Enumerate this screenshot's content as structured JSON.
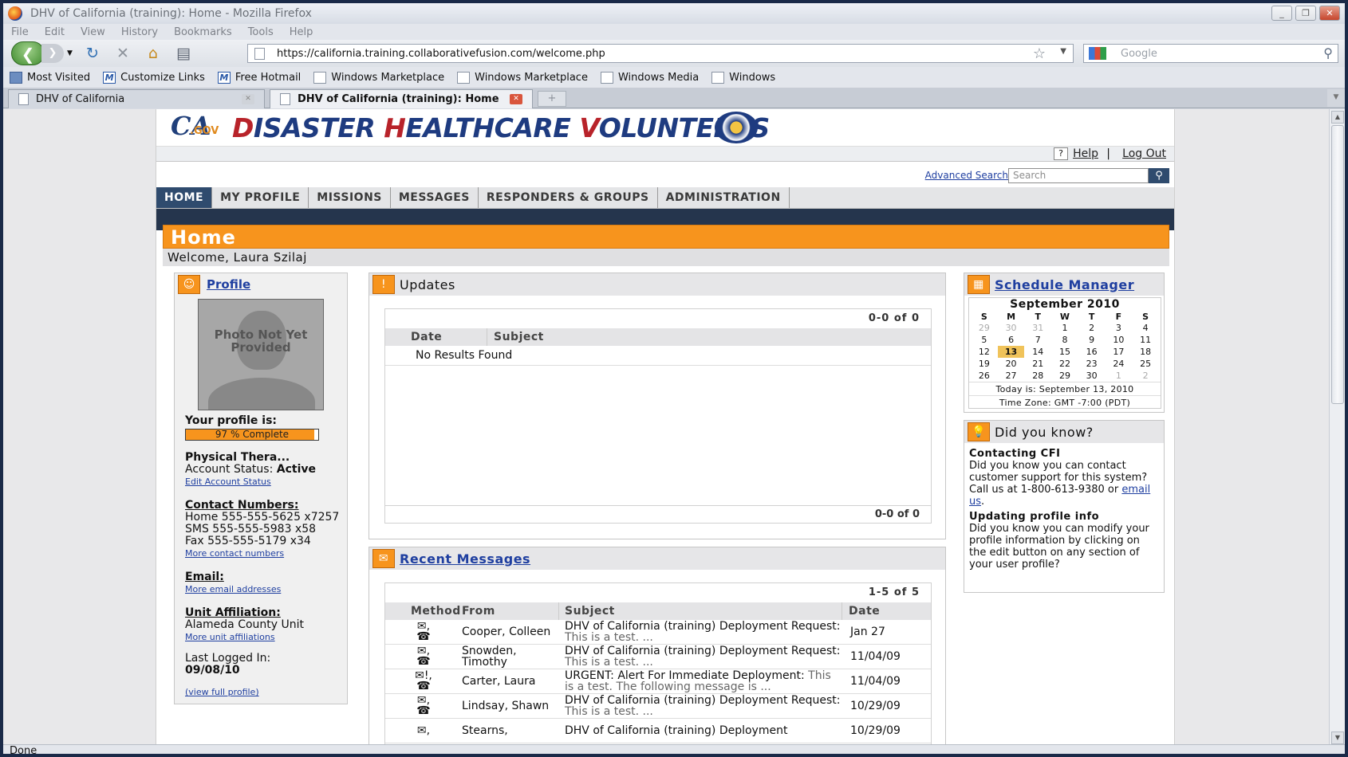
{
  "window": {
    "title": "DHV of California (training): Home - Mozilla Firefox"
  },
  "menu": [
    "File",
    "Edit",
    "View",
    "History",
    "Bookmarks",
    "Tools",
    "Help"
  ],
  "nav": {
    "url": "https://california.training.collaborativefusion.com/welcome.php",
    "search_placeholder": "Google"
  },
  "bookmarks": [
    {
      "label": "Most Visited"
    },
    {
      "label": "Customize Links"
    },
    {
      "label": "Free Hotmail"
    },
    {
      "label": "Windows Marketplace"
    },
    {
      "label": "Windows Marketplace"
    },
    {
      "label": "Windows Media"
    },
    {
      "label": "Windows"
    }
  ],
  "tabs": [
    {
      "label": "DHV of California"
    },
    {
      "label": "DHV of California (training): Home"
    }
  ],
  "site": {
    "logo_ca": "CA",
    "logo_gov": ".GOV",
    "logo_w1": "D",
    "logo_r1": "ISASTER ",
    "logo_w2": "H",
    "logo_r2": "EALTHCARE ",
    "logo_w3": "V",
    "logo_r3": "OLUNTEERS",
    "help": "Help",
    "logout": "Log Out",
    "advanced_search": "Advanced Search",
    "search_placeholder": "Search"
  },
  "mainnav": [
    "HOME",
    "MY PROFILE",
    "MISSIONS",
    "MESSAGES",
    "RESPONDERS & GROUPS",
    "ADMINISTRATION"
  ],
  "page": {
    "title": "Home",
    "welcome": "Welcome, Laura Szilaj"
  },
  "profile": {
    "heading": "Profile",
    "photo_text": "Photo Not Yet Provided",
    "your_profile": "Your profile is:",
    "complete_label": "97 % Complete",
    "complete_fraction": 0.97,
    "role": "Physical Thera...",
    "account_status_label": "Account Status:",
    "account_status": "Active",
    "edit_status": "Edit Account Status",
    "contact_heading": "Contact Numbers:",
    "home": "Home 555-555-5625 x7257",
    "sms": "SMS 555-555-5983 x58",
    "fax": "Fax 555-555-5179 x34",
    "more_contact": "More contact numbers",
    "email_heading": "Email:",
    "more_email": "More email addresses",
    "unit_heading": "Unit Affiliation:",
    "unit": "Alameda County Unit",
    "more_unit": "More unit affiliations",
    "last_logged_label": "Last Logged In:",
    "last_logged": "09/08/10",
    "view_full": "(view full profile)"
  },
  "updates": {
    "heading": "Updates",
    "pager": "0-0 of 0",
    "col_date": "Date",
    "col_subject": "Subject",
    "no_results": "No Results Found"
  },
  "messages": {
    "heading": "Recent Messages",
    "pager": "1-5 of 5",
    "cols": {
      "method": "Method",
      "from": "From",
      "subject": "Subject",
      "date": "Date"
    },
    "rows": [
      {
        "from": "Cooper, Colleen",
        "subject": "DHV of California (training) Deployment Request:",
        "preview": " This is a test. ...",
        "date": "Jan 27"
      },
      {
        "from": "Snowden, Timothy",
        "subject": "DHV of California (training) Deployment Request:",
        "preview": " This is a test. ...",
        "date": "11/04/09"
      },
      {
        "from": "Carter, Laura",
        "subject": "URGENT: Alert For Immediate Deployment:",
        "preview": " This is a test. The following message is ...",
        "date": "11/04/09"
      },
      {
        "from": "Lindsay, Shawn",
        "subject": "DHV of California (training) Deployment Request:",
        "preview": " This is a test. ...",
        "date": "10/29/09"
      },
      {
        "from": "Stearns,",
        "subject": "DHV of California (training) Deployment",
        "preview": "",
        "date": "10/29/09"
      }
    ]
  },
  "schedule": {
    "heading": "Schedule Manager",
    "month": "September 2010",
    "weekdays": [
      "S",
      "M",
      "T",
      "W",
      "T",
      "F",
      "S"
    ],
    "weeks": [
      [
        "29",
        "30",
        "31",
        "1",
        "2",
        "3",
        "4"
      ],
      [
        "5",
        "6",
        "7",
        "8",
        "9",
        "10",
        "11"
      ],
      [
        "12",
        "13",
        "14",
        "15",
        "16",
        "17",
        "18"
      ],
      [
        "19",
        "20",
        "21",
        "22",
        "23",
        "24",
        "25"
      ],
      [
        "26",
        "27",
        "28",
        "29",
        "30",
        "1",
        "2"
      ]
    ],
    "today": "Today is: September 13, 2010",
    "timezone": "Time Zone: GMT -7:00 (PDT)"
  },
  "didyouknow": {
    "heading": "Did you know?",
    "t1": "Contacting CFI",
    "p1": "Did you know you can contact customer support for this system? Call us at 1-800-613-9380 or ",
    "p1_link": "email us",
    "p1_end": ".",
    "t2": "Updating profile info",
    "p2": "Did you know you can modify your profile information by clicking on the edit button on any section of your user profile?"
  },
  "status": "Done"
}
